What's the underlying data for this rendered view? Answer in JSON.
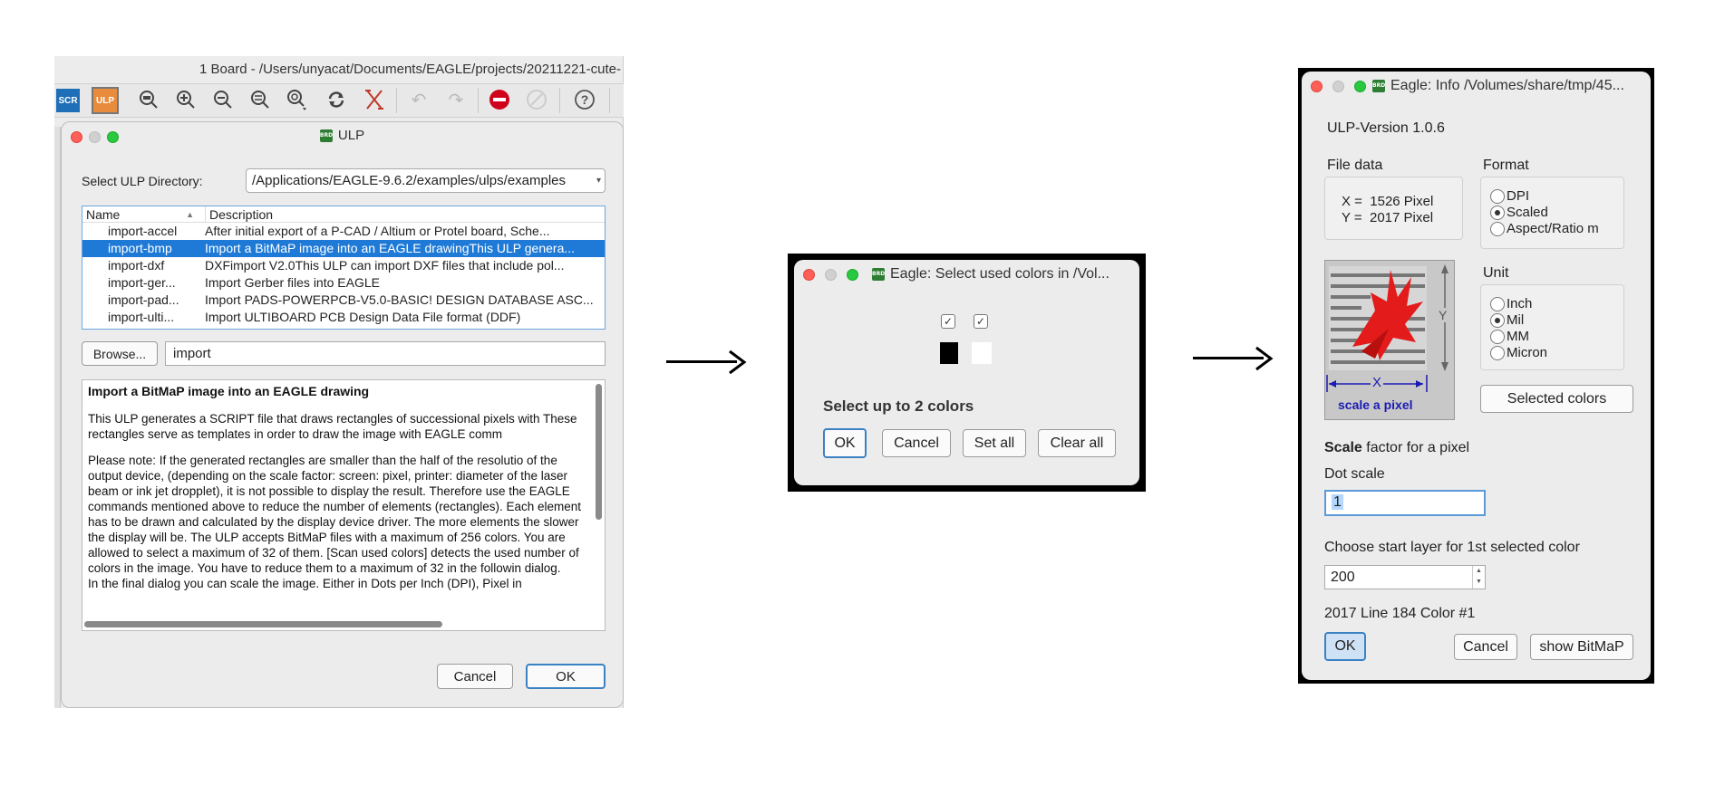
{
  "window": {
    "title": "1 Board - /Users/unyacat/Documents/EAGLE/projects/20211221-cute-",
    "toolbar": {
      "scr_label": "SCR",
      "ulp_label": "ULP"
    }
  },
  "ulp_dialog": {
    "title": "ULP",
    "badge": "BRD",
    "dir_label": "Select ULP Directory:",
    "dir_value": "/Applications/EAGLE-9.6.2/examples/ulps/examples",
    "col_name": "Name",
    "col_desc": "Description",
    "sort_indicator": "▲",
    "rows": [
      {
        "name": "import-accel",
        "desc": "After initial export of a P-CAD / Altium or Protel board, Sche..."
      },
      {
        "name": "import-bmp",
        "desc": "Import a BitMaP image into an EAGLE drawingThis ULP genera..."
      },
      {
        "name": "import-dxf",
        "desc": "DXFimport V2.0This ULP can import DXF files that include pol..."
      },
      {
        "name": "import-ger...",
        "desc": "Import Gerber files into EAGLE"
      },
      {
        "name": "import-pad...",
        "desc": "Import PADS-POWERPCB-V5.0-BASIC! DESIGN DATABASE ASC..."
      },
      {
        "name": "import-ulti...",
        "desc": "Import ULTIBOARD PCB Design Data File format (DDF)"
      }
    ],
    "browse_label": "Browse...",
    "search_value": "import",
    "desc_heading": "Import a BitMaP image into an EAGLE drawing",
    "desc_p1": "This ULP generates a SCRIPT file that draws rectangles of successional pixels with These rectangles serve as templates in order to draw the image with EAGLE comm",
    "desc_p2": "Please note: If the generated rectangles are smaller than the half of the resolutio of the output device, (depending on the scale factor: screen: pixel, printer: diameter of the laser beam or ink jet dropplet), it is not possible to display the result. Therefore use the EAGLE commands mentioned above to reduce the number of elements (rectangles). Each element has to be drawn and calculated by the display device driver. The more elements the slower the display will be. The ULP accepts BitMaP files with a maximum of 256 colors. You are allowed to select a maximum of 32 of them. [Scan used colors] detects the used number of colors in the image. You have to reduce them to a maximum of 32 in the followin dialog.",
    "desc_p3": "In the final dialog you can scale the image. Either in Dots per Inch (DPI), Pixel in",
    "cancel_label": "Cancel",
    "ok_label": "OK"
  },
  "color_dialog": {
    "title": "Eagle: Select used colors in /Vol...",
    "badge": "BRD",
    "checks": [
      "✓",
      "✓"
    ],
    "swatches": [
      "#000000",
      "#ffffff"
    ],
    "prompt": "Select up to 2 colors",
    "ok_label": "OK",
    "cancel_label": "Cancel",
    "setall_label": "Set all",
    "clearall_label": "Clear all"
  },
  "info_dialog": {
    "title": "Eagle: Info /Volumes/share/tmp/45...",
    "badge": "BRD",
    "version": "ULP-Version 1.0.6",
    "file_data_label": "File data",
    "x_line": "X =  1526 Pixel",
    "y_line": "Y =  2017 Pixel",
    "format_label": "Format",
    "format_options": [
      "DPI",
      "Scaled",
      "Aspect/Ratio m"
    ],
    "format_selected": "Scaled",
    "unit_label": "Unit",
    "unit_options": [
      "Inch",
      "Mil",
      "MM",
      "Micron"
    ],
    "unit_selected": "Mil",
    "image_caption": "scale a pixel",
    "image_x": "X",
    "image_y": "Y",
    "selected_colors_label": "Selected colors",
    "scale_bold": "Scale",
    "scale_rest": " factor for a pixel",
    "dot_scale_label": "Dot scale",
    "dot_scale_value": "1",
    "layer_label": "Choose start layer for 1st selected color",
    "layer_value": "200",
    "status": "2017 Line 184 Color #1",
    "ok_label": "OK",
    "cancel_label": "Cancel",
    "show_label": "show BitMaP"
  },
  "arrows": [
    "→",
    "→"
  ]
}
